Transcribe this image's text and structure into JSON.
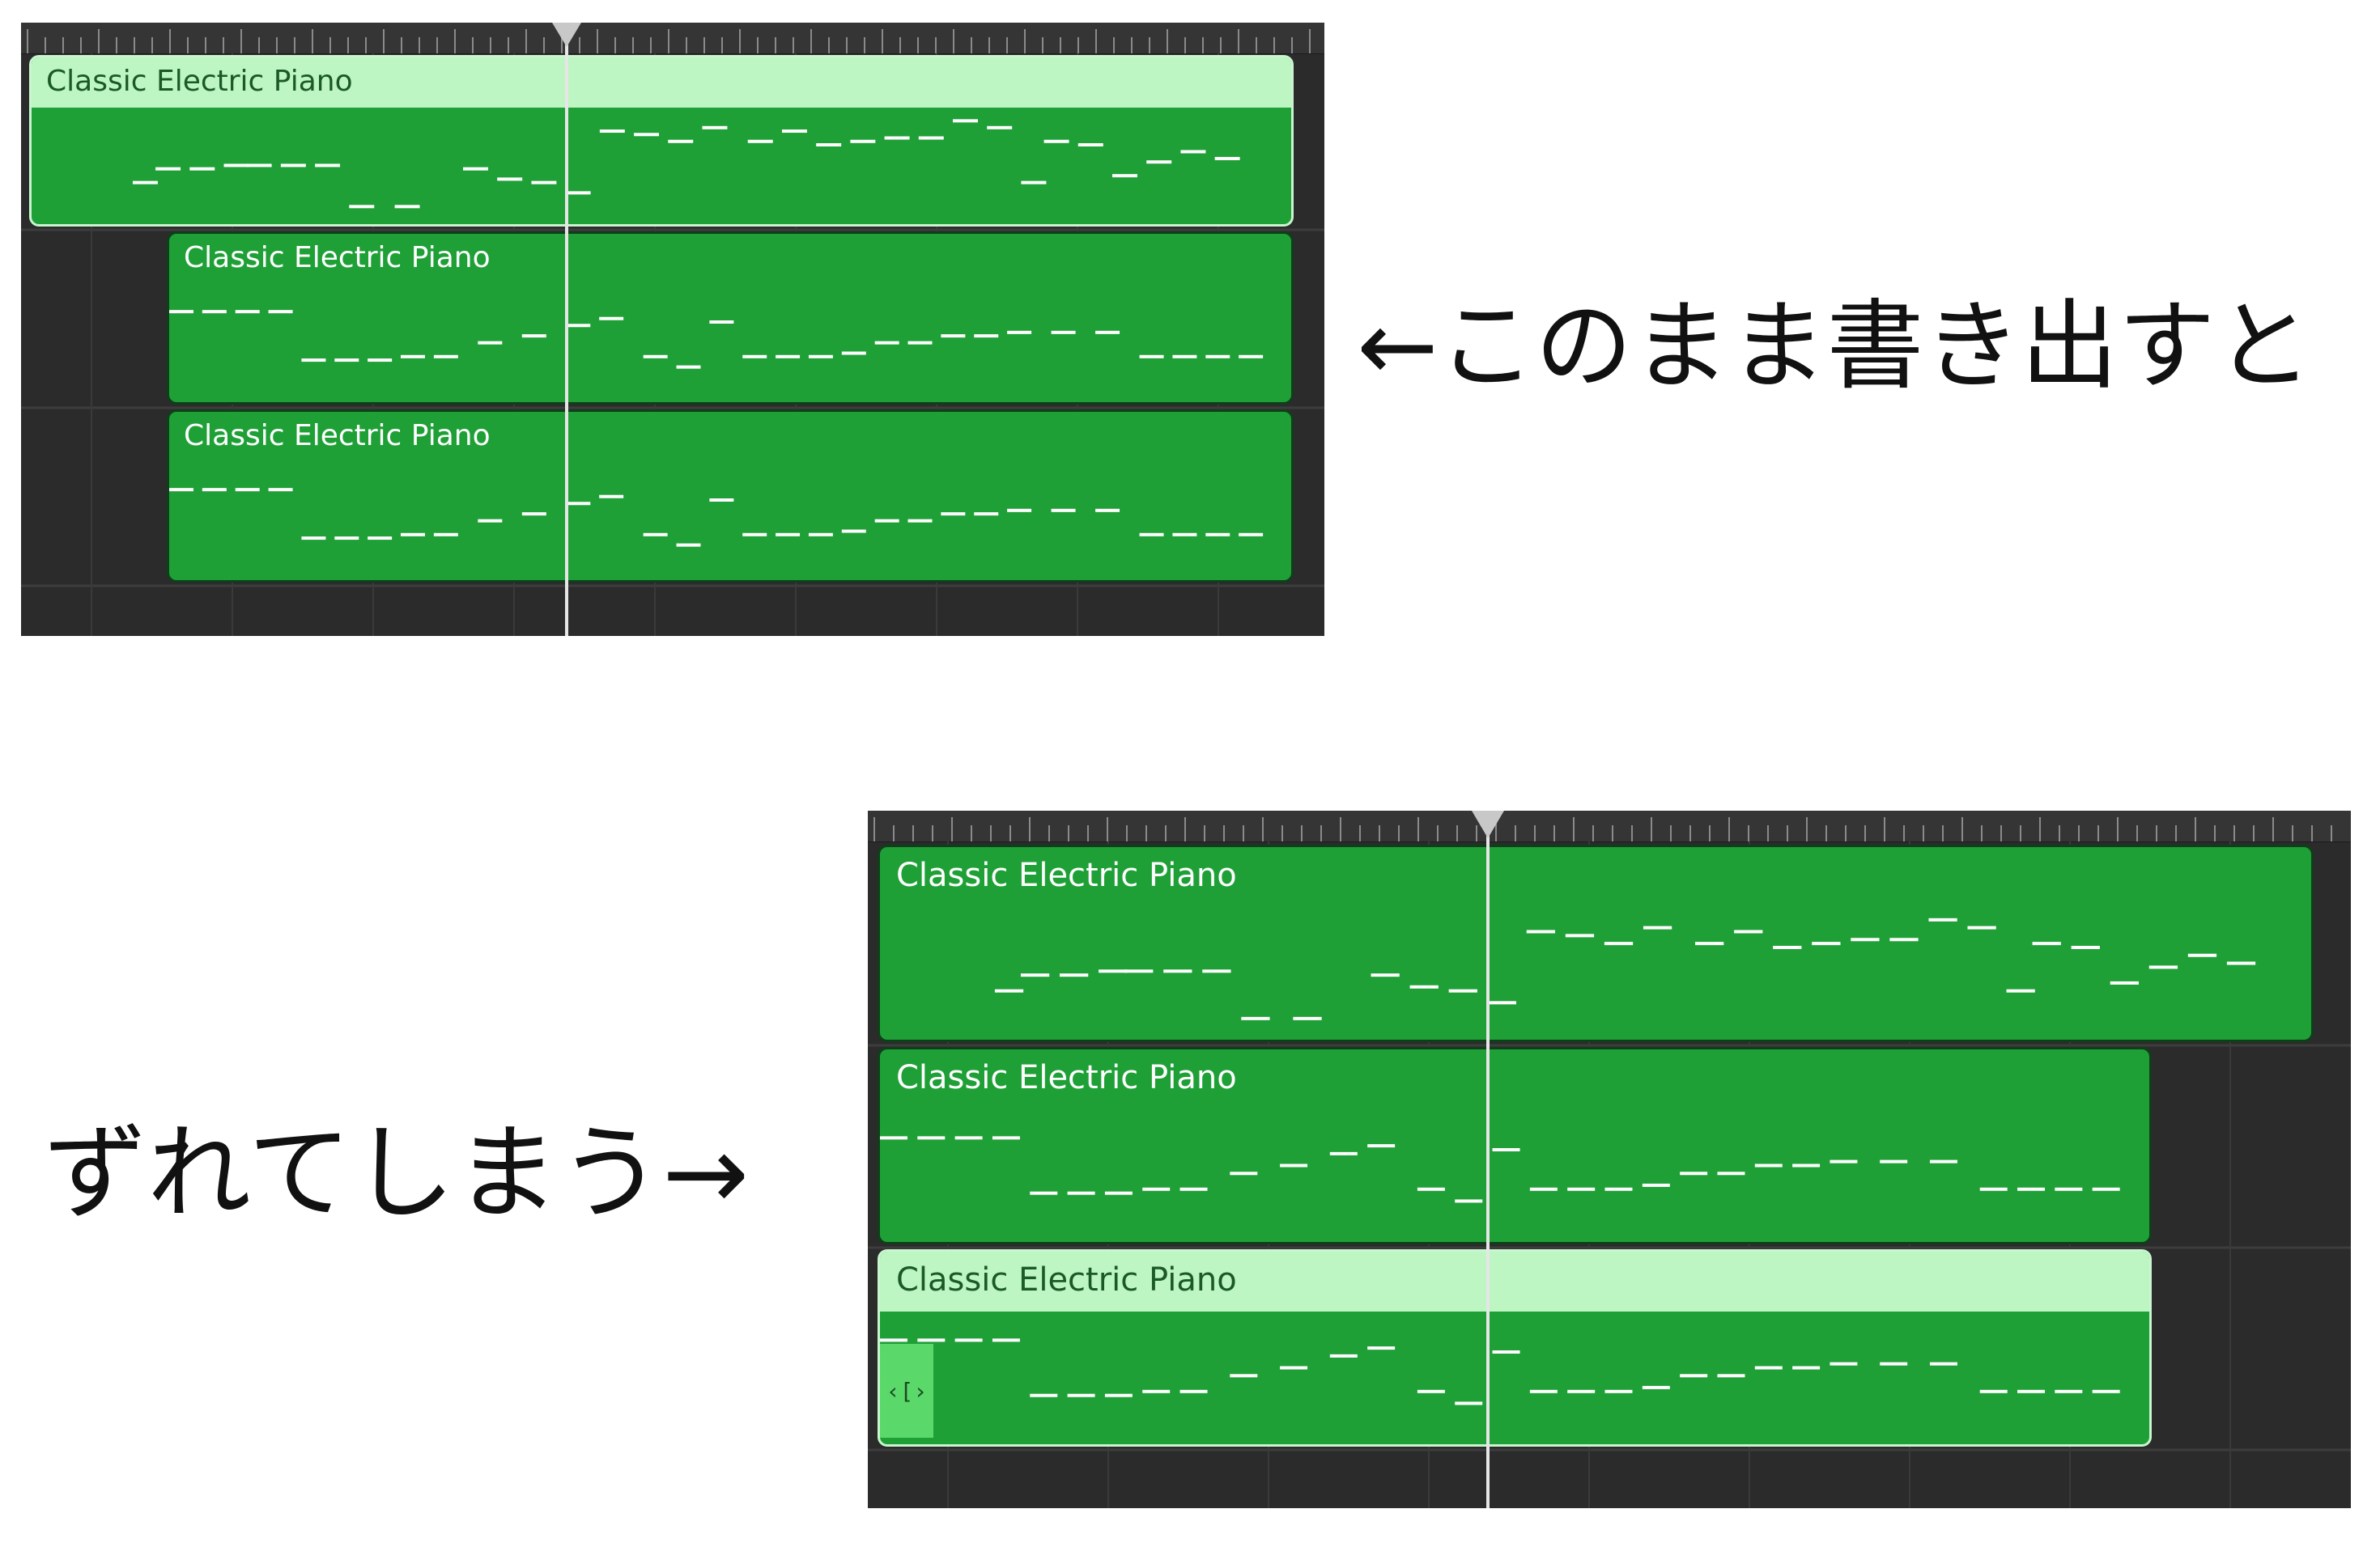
{
  "top_screenshot": {
    "regions": [
      {
        "name": "Classic Electric Piano",
        "selected": true
      },
      {
        "name": "Classic Electric Piano",
        "selected": false
      },
      {
        "name": "Classic Electric Piano",
        "selected": false
      }
    ]
  },
  "bottom_screenshot": {
    "regions": [
      {
        "name": "Classic Electric Piano",
        "selected": false
      },
      {
        "name": "Classic Electric Piano",
        "selected": false
      },
      {
        "name": "Classic Electric Piano",
        "selected": true
      }
    ],
    "loop_handle_glyph": "‹[›"
  },
  "captions": {
    "right": "←このまま書き出すと",
    "left": "ずれてしまう→"
  },
  "colors": {
    "region_fill": "#1fa037",
    "selected_header": "#bdf5c3",
    "track_background": "#2b2b2b"
  }
}
